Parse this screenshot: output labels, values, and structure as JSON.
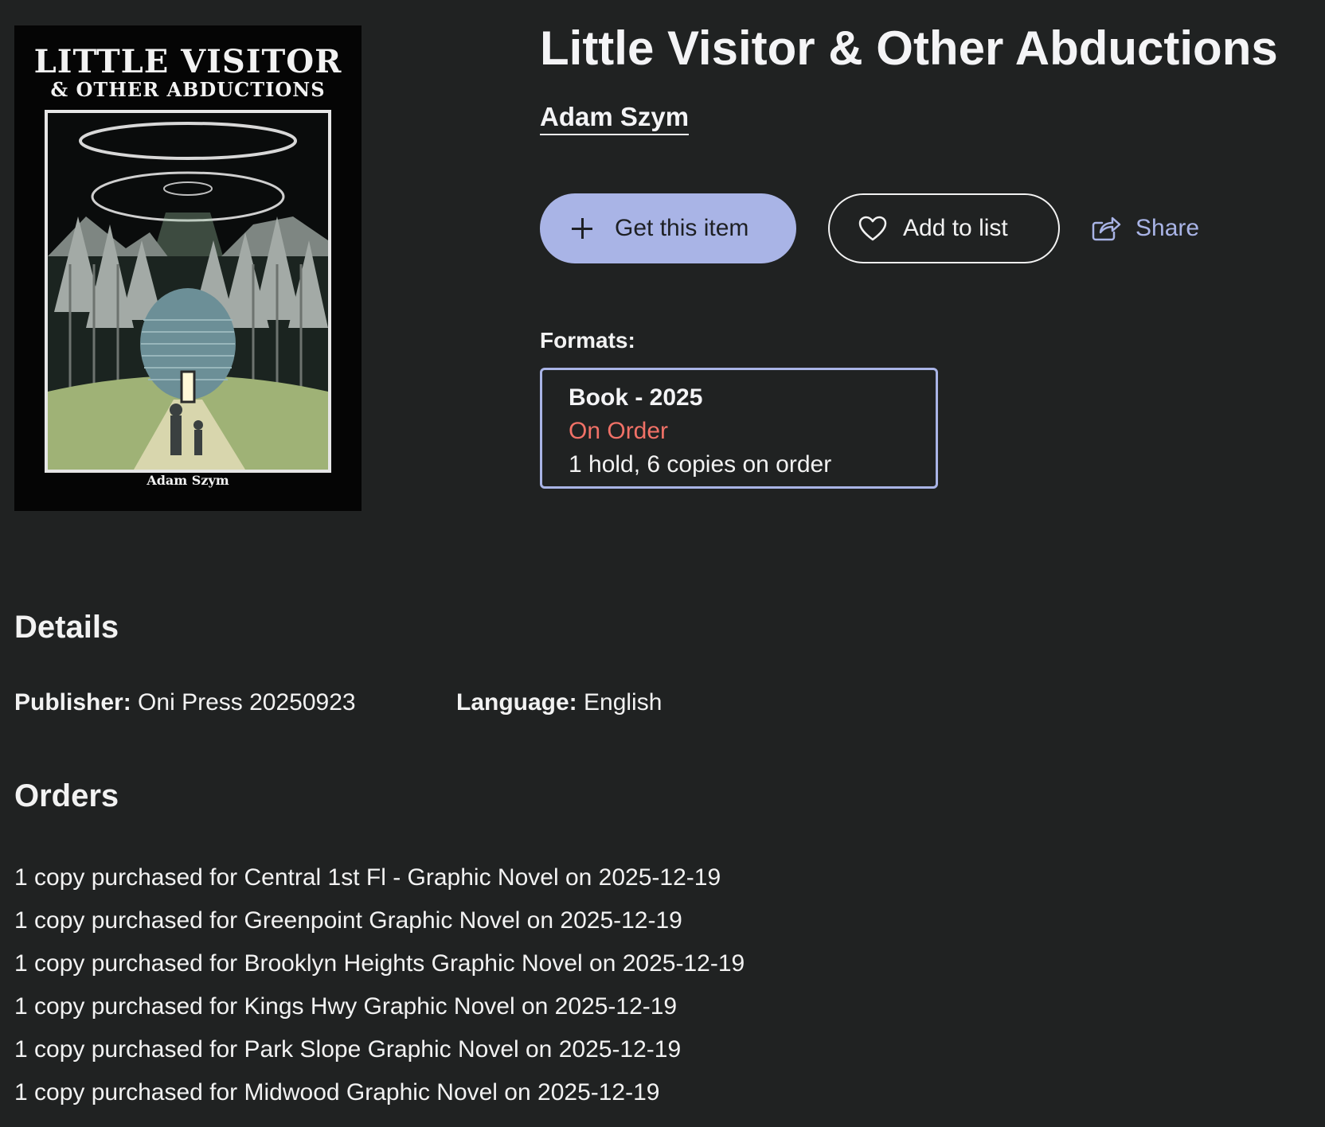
{
  "cover": {
    "title_line1": "LITTLE VISITOR",
    "title_line2": "& OTHER ABDUCTIONS",
    "author": "Adam Szym"
  },
  "item": {
    "title": "Little Visitor & Other Abductions",
    "author": "Adam Szym"
  },
  "actions": {
    "get_label": "Get this item",
    "list_label": "Add to list",
    "share_label": "Share"
  },
  "formats": {
    "label": "Formats:",
    "items": [
      {
        "name": "Book - 2025",
        "status": "On Order",
        "availability": "1 hold, 6 copies on order"
      }
    ]
  },
  "details": {
    "heading": "Details",
    "publisher_label": "Publisher:",
    "publisher_value": "Oni Press 20250923",
    "language_label": "Language:",
    "language_value": "English"
  },
  "orders": {
    "heading": "Orders",
    "items": [
      "1 copy purchased for Central 1st Fl - Graphic Novel on 2025-12-19",
      "1 copy purchased for Greenpoint Graphic Novel on 2025-12-19",
      "1 copy purchased for Brooklyn Heights Graphic Novel on 2025-12-19",
      "1 copy purchased for Kings Hwy Graphic Novel on 2025-12-19",
      "1 copy purchased for Park Slope Graphic Novel on 2025-12-19",
      "1 copy purchased for Midwood Graphic Novel on 2025-12-19"
    ]
  },
  "colors": {
    "background": "#202222",
    "accent": "#a9b4e6",
    "status_on_order": "#f07167",
    "text": "#f2f2f2"
  },
  "icons": {
    "get": "plus-icon",
    "list": "heart-icon",
    "share": "share-icon"
  }
}
